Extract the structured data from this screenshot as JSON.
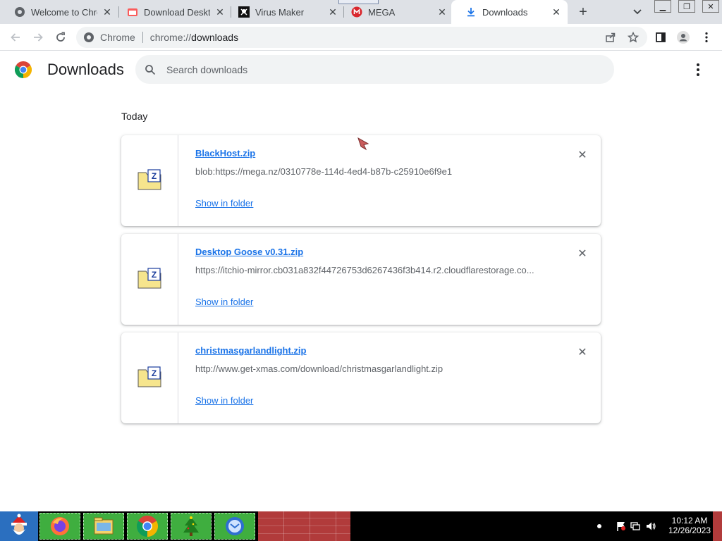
{
  "tabs": [
    {
      "title": "Welcome to Chro",
      "favicon": "chrome-icon",
      "active": false
    },
    {
      "title": "Download Deskto",
      "favicon": "itchio-icon",
      "active": false
    },
    {
      "title": "Virus Maker",
      "favicon": "pirate-flag-icon",
      "active": false
    },
    {
      "title": "MEGA",
      "favicon": "mega-icon",
      "active": false
    },
    {
      "title": "Downloads",
      "favicon": "download-icon",
      "active": true
    }
  ],
  "omnibox": {
    "chip_label": "Chrome",
    "url_scheme": "chrome://",
    "url_rest": "downloads"
  },
  "page": {
    "title": "Downloads",
    "search_placeholder": "Search downloads",
    "section_label": "Today"
  },
  "downloads": [
    {
      "name": "BlackHost.zip",
      "url": "blob:https://mega.nz/0310778e-114d-4ed4-b87b-c25910e6f9e1",
      "action": "Show in folder"
    },
    {
      "name": "Desktop Goose v0.31.zip",
      "url": "https://itchio-mirror.cb031a832f44726753d6267436f3b414.r2.cloudflarestorage.co...",
      "action": "Show in folder"
    },
    {
      "name": "christmasgarlandlight.zip",
      "url": "http://www.get-xmas.com/download/christmasgarlandlight.zip",
      "action": "Show in folder"
    }
  ],
  "taskbar": {
    "time": "10:12 AM",
    "date": "12/26/2023",
    "items": [
      "santa-start-icon",
      "firefox-icon",
      "file-explorer-icon",
      "chrome-icon",
      "christmas-tree-icon",
      "mail-icon"
    ]
  },
  "colors": {
    "link": "#1a73e8",
    "tabstrip": "#dee1e6",
    "taskbar_green": "#3fae3f",
    "taskbar_red": "#b13b3b"
  }
}
